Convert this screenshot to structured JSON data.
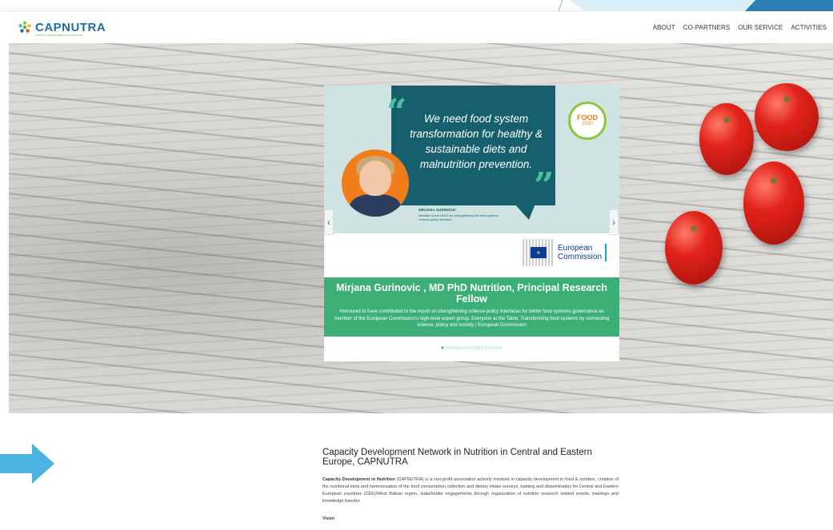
{
  "header": {
    "brand": "CAPNUTRA",
    "tagline": "CAPACITY DEVELOPMENT IN NUTRITION",
    "nav": [
      "ABOUT",
      "CO-PARTNERS",
      "OUR SERVICE",
      "ACTIVITIES"
    ]
  },
  "slider": {
    "quote": "We need food system transformation for healthy & sustainable diets and malnutrition prevention.",
    "badge_line1": "FOOD",
    "badge_line2": "2030",
    "person_name": "MIRJANA GURINOVIC",
    "person_role": "Member of the HLEG on strengthening the food systems science-policy interface",
    "ec_line1": "European",
    "ec_line2": "Commission",
    "prev_icon": "‹",
    "next_icon": "›",
    "caption_title": "Mirjana Gurinovic , MD PhD Nutrition, Principal Research Fellow",
    "caption_text": "Honoured to have contributed to the report on strengthening science-policy interfaces for better food systems governance as member of the European Commission's high-level expert group. Everyone at the Table: Transforming food systems by connecting science, policy and society | European Commission",
    "dots": "●○○○○○○○○○○○○○○○○",
    "active_slide": 1,
    "total_slides": 17
  },
  "content": {
    "title": "Capacity Development Network in Nutrition in Central and Eastern Europe, CAPNUTRA",
    "intro_bold": "Capacity Development in Nutrition",
    "intro_text": " (CAPNUTRA) is a non-profit association actively involved in capacity development in food & nutrition, creation of the nutritional tools and harmonisation of the food consumption collection and dietary intake surveys, training and dissemination for Central and Eastern European countries (CEE)/West Balkan region, stakeholder engagements through organization of nutrition research related events, trainings and knowledge transfer.",
    "vision_label": "Vision"
  },
  "colors": {
    "brand_blue": "#1d6fa8",
    "teal": "#16606e",
    "green": "#3caf77",
    "orange": "#f07d1a",
    "arrow_blue": "#4ab3e2"
  },
  "icons": {
    "logo": "flower-logo-icon",
    "prev": "chevron-left-icon",
    "next": "chevron-right-icon",
    "arrow": "right-arrow-icon"
  }
}
